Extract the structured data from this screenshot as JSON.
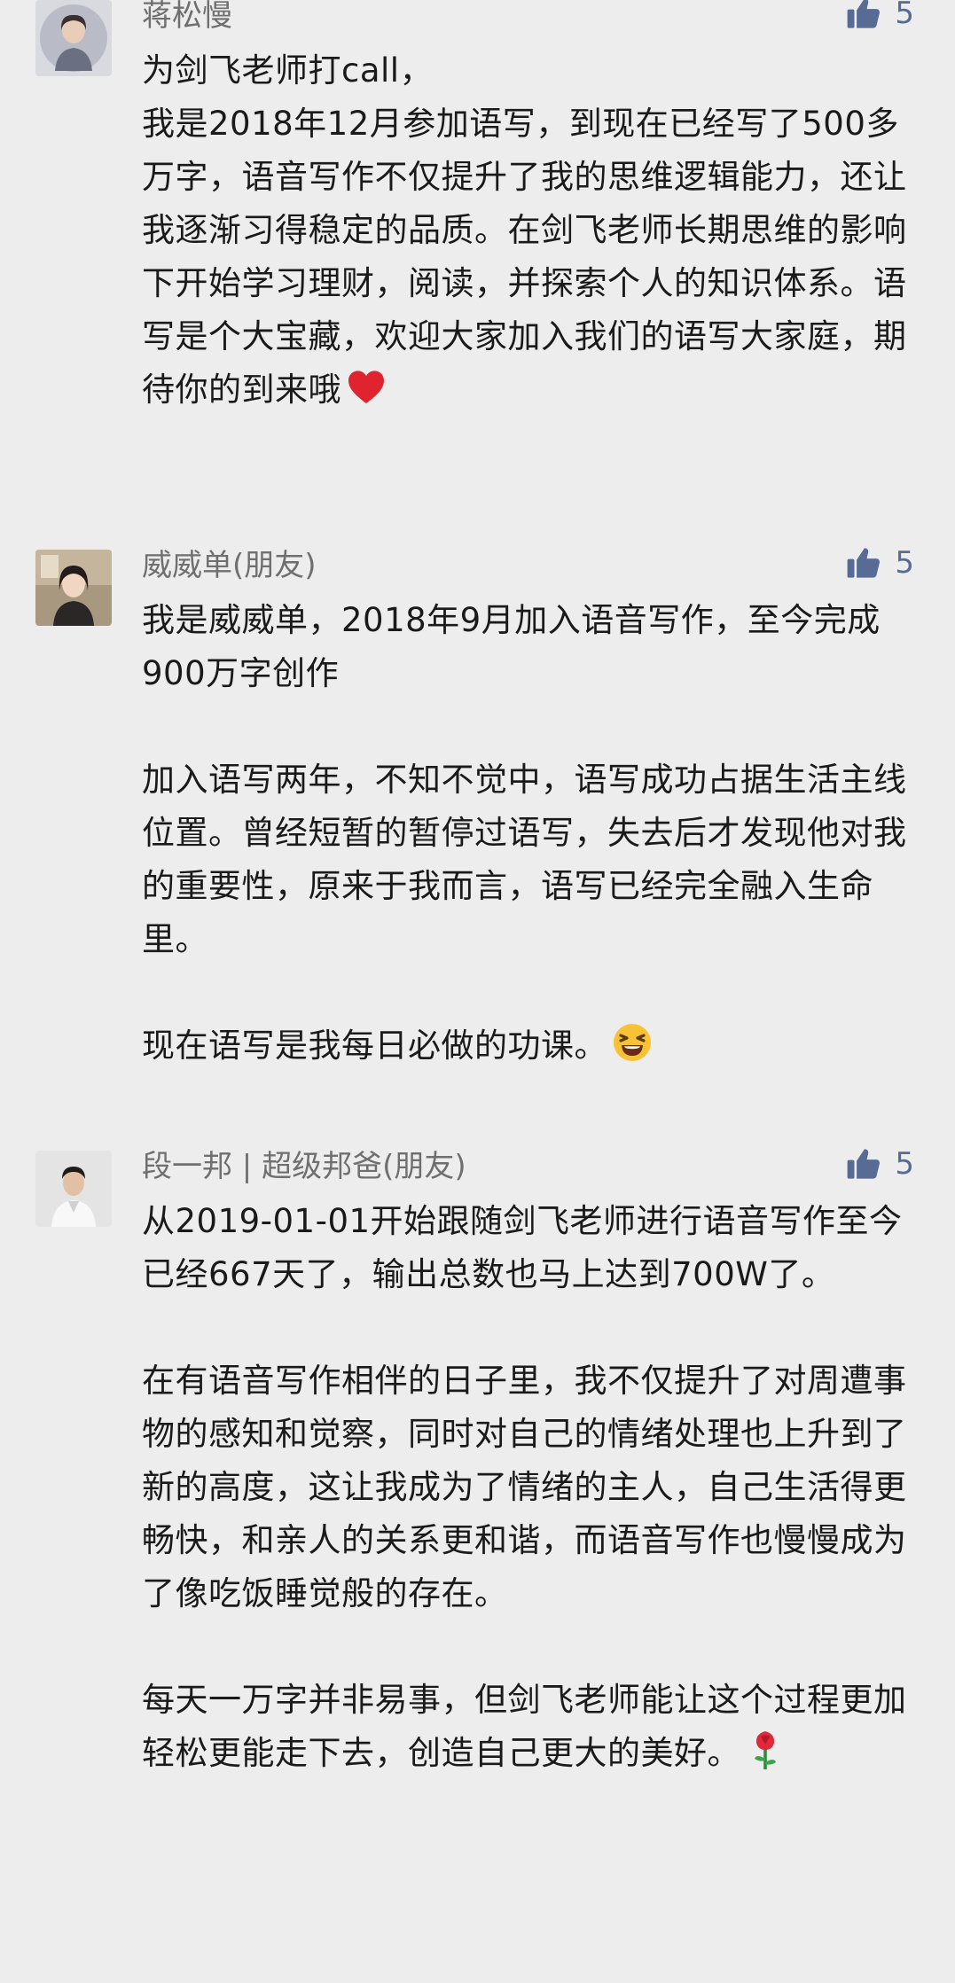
{
  "comments": [
    {
      "author": "蒋松慢",
      "likes": "5",
      "avatar_icon": "woman-portrait-avatar",
      "paragraphs": [
        "为剑飞老师打call，\n我是2018年12月参加语写，到现在已经写了500多万字，语音写作不仅提升了我的思维逻辑能力，还让我逐渐习得稳定的品质。在剑飞老师长期思维的影响下开始学习理财，阅读，并探索个人的知识体系。语写是个大宝藏，欢迎大家加入我们的语写大家庭，期待你的到来哦"
      ],
      "trailing_emoji": "red-heart-emoji"
    },
    {
      "author": "威威单(朋友)",
      "likes": "5",
      "avatar_icon": "woman-photo-avatar",
      "paragraphs": [
        "我是威威单，2018年9月加入语音写作，至今完成900万字创作",
        "加入语写两年，不知不觉中，语写成功占据生活主线位置。曾经短暂的暂停过语写，失去后才发现他对我的重要性，原来于我而言，语写已经完全融入生命里。",
        "现在语写是我每日必做的功课。"
      ],
      "trailing_emoji": "laughing-face-emoji"
    },
    {
      "author": "段一邦 | 超级邦爸(朋友)",
      "likes": "5",
      "avatar_icon": "man-photo-avatar",
      "paragraphs": [
        "从2019-01-01开始跟随剑飞老师进行语音写作至今已经667天了，输出总数也马上达到700W了。",
        "在有语音写作相伴的日子里，我不仅提升了对周遭事物的感知和觉察，同时对自己的情绪处理也上升到了新的高度，这让我成为了情绪的主人，自己生活得更畅快，和亲人的关系更和谐，而语音写作也慢慢成为了像吃饭睡觉般的存在。",
        "每天一万字并非易事，但剑飞老师能让这个过程更加轻松更能走下去，创造自己更大的美好。"
      ],
      "trailing_emoji": "rose-emoji"
    }
  ],
  "colors": {
    "background": "#ededed",
    "text": "#1a1a1a",
    "author": "#6f6f6f",
    "like_accent": "#576b95"
  }
}
